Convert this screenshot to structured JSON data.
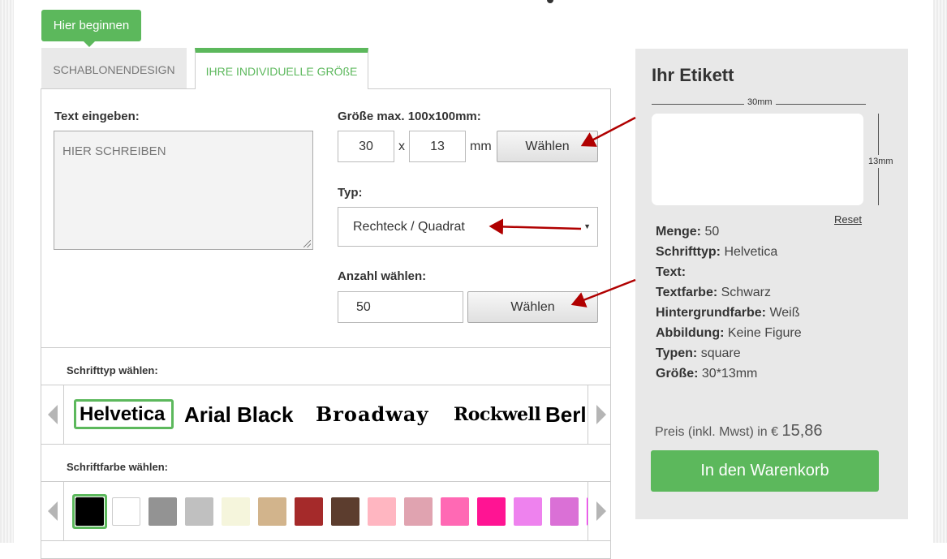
{
  "start_button": "Hier beginnen",
  "tabs": [
    {
      "label": "SCHABLONENDESIGN",
      "active": false
    },
    {
      "label": "IHRE INDIVIDUELLE GRÖßE",
      "active": true
    }
  ],
  "form": {
    "text_label": "Text eingeben:",
    "text_placeholder": "HIER SCHREIBEN",
    "size_label": "Größe max. 100x100mm:",
    "width_value": "30",
    "times": "x",
    "height_value": "13",
    "unit": "mm",
    "size_button": "Wählen",
    "type_label": "Typ:",
    "type_selected": "Rechteck / Quadrat",
    "quantity_label": "Anzahl wählen:",
    "quantity_value": "50",
    "quantity_button": "Wählen"
  },
  "font_section": {
    "label": "Schrifttyp wählen:",
    "fonts": [
      "Helvetica",
      "Arial Black",
      "Broadway",
      "Rockwell",
      "Berl"
    ],
    "selected": "Helvetica"
  },
  "color_section": {
    "label": "Schriftfarbe wählen:",
    "swatches": [
      "#000000",
      "#ffffff",
      "#939393",
      "#c0c0c0",
      "#f5f5dc",
      "#d2b48c",
      "#a52a2a",
      "#5c3d2e",
      "#ffb6c1",
      "#e0a3b0",
      "#ff69b4",
      "#ff1493",
      "#ee82ee",
      "#da70d6",
      "#ff00ff"
    ],
    "selected": "#000000"
  },
  "summary": {
    "title": "Ihr Etikett",
    "width_label": "30mm",
    "height_label": "13mm",
    "reset": "Reset",
    "rows": [
      {
        "key": "Menge:",
        "value": "50"
      },
      {
        "key": "Schrifttyp:",
        "value": "Helvetica"
      },
      {
        "key": "Text:",
        "value": ""
      },
      {
        "key": "Textfarbe:",
        "value": "Schwarz"
      },
      {
        "key": "Hintergrundfarbe:",
        "value": "Weiß"
      },
      {
        "key": "Abbildung:",
        "value": "Keine Figure"
      },
      {
        "key": "Typen:",
        "value": "square"
      },
      {
        "key": "Größe:",
        "value": "30*13mm"
      }
    ],
    "price_label": "Preis (inkl. Mwst) in €",
    "price_value": "15,86",
    "cart_button": "In den Warenkorb"
  },
  "colors": {
    "accent": "#5cb85c",
    "annotation_arrow": "#b00000"
  }
}
